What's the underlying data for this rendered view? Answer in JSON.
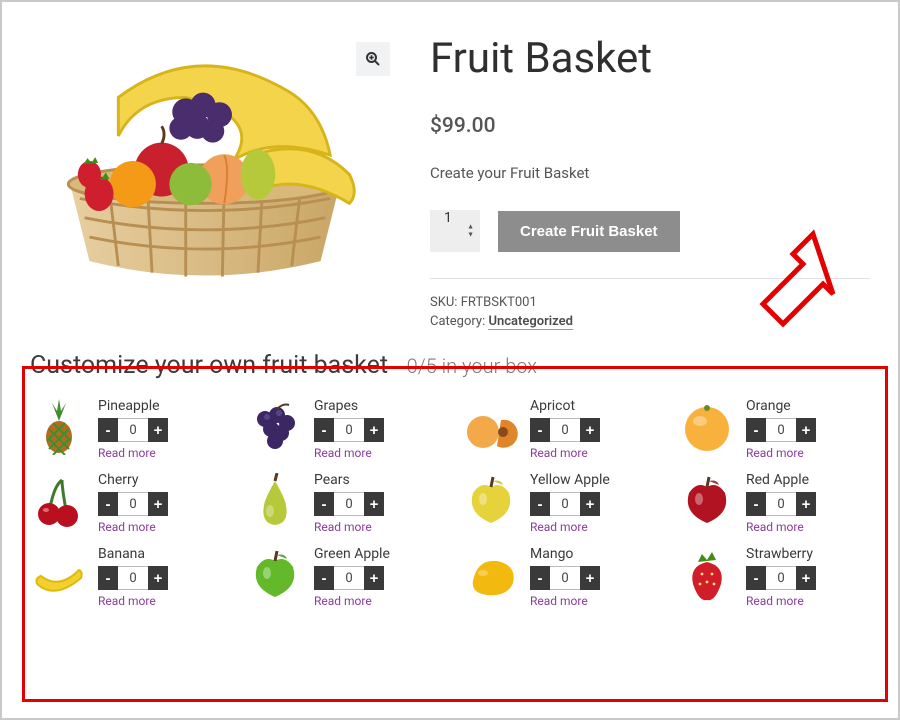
{
  "product": {
    "title": "Fruit Basket",
    "price": "$99.00",
    "description": "Create your Fruit Basket",
    "quantity": "1",
    "create_button": "Create Fruit Basket",
    "sku_label": "SKU:",
    "sku": "FRTBSKT001",
    "category_label": "Category:",
    "category": "Uncategorized"
  },
  "customize": {
    "heading": "Customize your own fruit basket",
    "subheading": "- 0/5 in your box",
    "read_more": "Read more",
    "minus": "-",
    "plus": "+",
    "default_qty": "0",
    "items": [
      {
        "name": "Pineapple",
        "icon": "pineapple",
        "colors": [
          "#b76b1e",
          "#3e8f2f"
        ]
      },
      {
        "name": "Grapes",
        "icon": "grapes",
        "colors": [
          "#3a2763",
          "#6b56a0"
        ]
      },
      {
        "name": "Apricot",
        "icon": "apricot",
        "colors": [
          "#f3a84a",
          "#e0862a"
        ]
      },
      {
        "name": "Orange",
        "icon": "orange",
        "colors": [
          "#f8b13d",
          "#f49a18"
        ]
      },
      {
        "name": "Cherry",
        "icon": "cherry",
        "colors": [
          "#b90f1f",
          "#3f7a2b"
        ]
      },
      {
        "name": "Pears",
        "icon": "pear",
        "colors": [
          "#b6c93a",
          "#8aa527"
        ]
      },
      {
        "name": "Yellow Apple",
        "icon": "apple",
        "colors": [
          "#e6d23a",
          "#c7b51d"
        ]
      },
      {
        "name": "Red Apple",
        "icon": "apple",
        "colors": [
          "#b21323",
          "#7f0e18"
        ]
      },
      {
        "name": "Banana",
        "icon": "banana",
        "colors": [
          "#f4d02e",
          "#e0b90f"
        ]
      },
      {
        "name": "Green Apple",
        "icon": "apple",
        "colors": [
          "#63b92a",
          "#3f8e18"
        ]
      },
      {
        "name": "Mango",
        "icon": "mango",
        "colors": [
          "#f2b90e",
          "#e89308"
        ]
      },
      {
        "name": "Strawberry",
        "icon": "strawberry",
        "colors": [
          "#d11c2a",
          "#3f8e18"
        ]
      }
    ]
  }
}
